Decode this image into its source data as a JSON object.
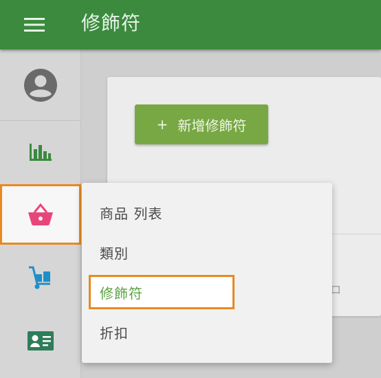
{
  "app_bar": {
    "title": "修飾符",
    "menu_icon": "hamburger-menu-icon",
    "background": "#3b8a3e"
  },
  "sidebar": {
    "profile_icon": "account-circle-icon",
    "items": [
      {
        "icon": "bar-chart-icon",
        "color": "#3b8a3e",
        "active": false
      },
      {
        "icon": "shopping-basket-icon",
        "color": "#e8457a",
        "active": true
      },
      {
        "icon": "hand-truck-icon",
        "color": "#1f8fc9",
        "active": false
      },
      {
        "icon": "contact-card-icon",
        "color": "#2e7d5a",
        "active": false
      }
    ]
  },
  "main": {
    "add_button": {
      "plus": "+",
      "label": "新增修飾符",
      "color": "#78a844"
    },
    "peek_text": "ロ"
  },
  "popup_menu": {
    "items": [
      {
        "label": "商品 列表",
        "selected": false
      },
      {
        "label": "類別",
        "selected": false
      },
      {
        "label": "修飾符",
        "selected": true,
        "color": "#5aa342"
      },
      {
        "label": "折扣",
        "selected": false
      }
    ]
  },
  "highlight_color": "#e8891f"
}
